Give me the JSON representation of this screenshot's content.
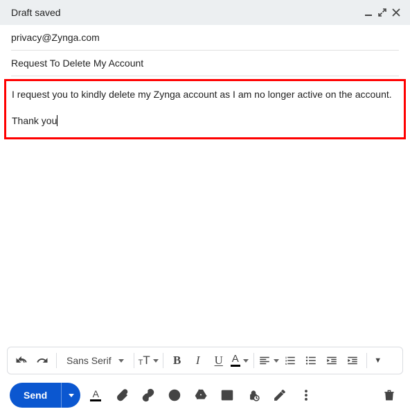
{
  "header": {
    "title": "Draft saved"
  },
  "fields": {
    "to": "privacy@Zynga.com",
    "subject": "Request To Delete My Account"
  },
  "body": {
    "line1": "I request you to kindly delete my Zynga account as I am no longer active on the account.",
    "line2": "Thank you"
  },
  "format": {
    "font_family": "Sans Serif"
  },
  "actions": {
    "send_label": "Send"
  }
}
